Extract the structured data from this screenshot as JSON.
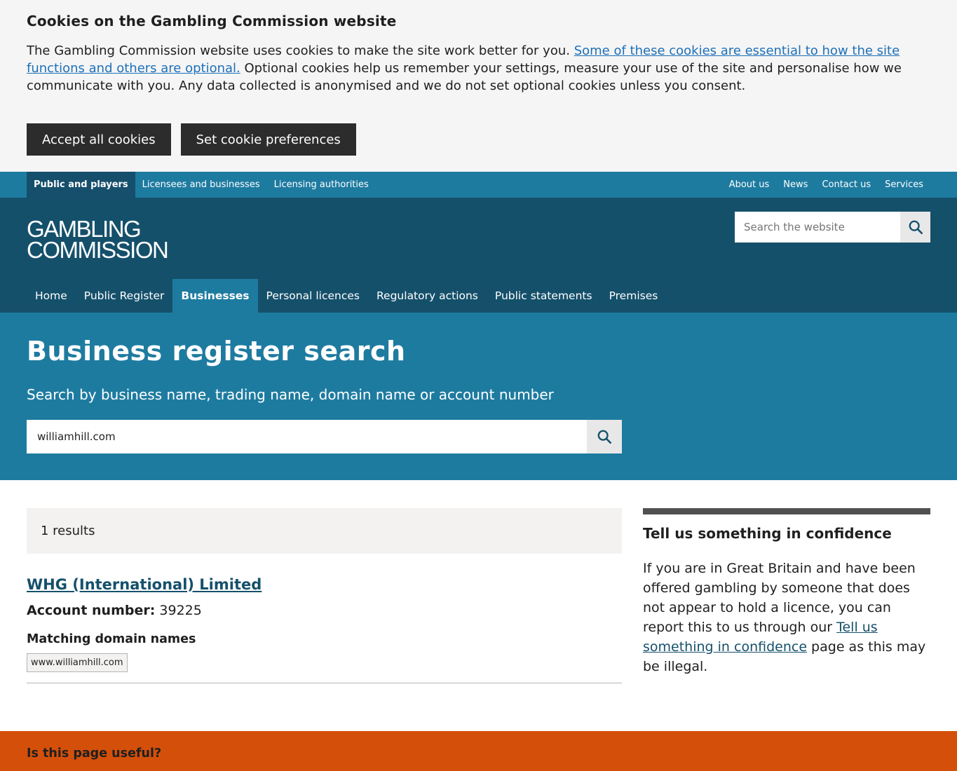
{
  "cookie_banner": {
    "title": "Cookies on the Gambling Commission website",
    "text_intro": "The Gambling Commission website uses cookies to make the site work better for you. ",
    "link_text": "Some of these cookies are essential to how the site functions and others are optional.",
    "text_rest": " Optional cookies help us remember your settings, measure your use of the site and personalise how we communicate with you. Any data collected is anonymised and we do not set optional cookies unless you consent.",
    "accept_label": "Accept all cookies",
    "preferences_label": "Set cookie preferences"
  },
  "top_nav": {
    "left": [
      "Public and players",
      "Licensees and businesses",
      "Licensing authorities"
    ],
    "right": [
      "About us",
      "News",
      "Contact us",
      "Services"
    ]
  },
  "header": {
    "logo_line1": "GAMBLING",
    "logo_line2": "COMMISSION",
    "search_placeholder": "Search the website"
  },
  "main_nav": [
    "Home",
    "Public Register",
    "Businesses",
    "Personal licences",
    "Regulatory actions",
    "Public statements",
    "Premises"
  ],
  "hero": {
    "title": "Business register search",
    "subtitle": "Search by business name, trading name, domain name or account number",
    "search_value": "williamhill.com"
  },
  "results": {
    "count_text": "1 results",
    "items": [
      {
        "name": "WHG (International) Limited",
        "account_label": "Account number:",
        "account_number": "39225",
        "domains_heading": "Matching domain names",
        "domains": [
          "www.williamhill.com"
        ]
      }
    ]
  },
  "aside": {
    "title": "Tell us something in confidence",
    "text_before": "If you are in Great Britain and have been offered gambling by someone that does not appear to hold a licence, you can report this to us through our ",
    "link_text": "Tell us something in confidence",
    "text_after": " page as this may be illegal."
  },
  "feedback": {
    "question": "Is this page useful?"
  },
  "colors": {
    "top_nav": "#1e7ba0",
    "header": "#15506b",
    "hero": "#1e7ba0",
    "feedback": "#d4500a"
  }
}
